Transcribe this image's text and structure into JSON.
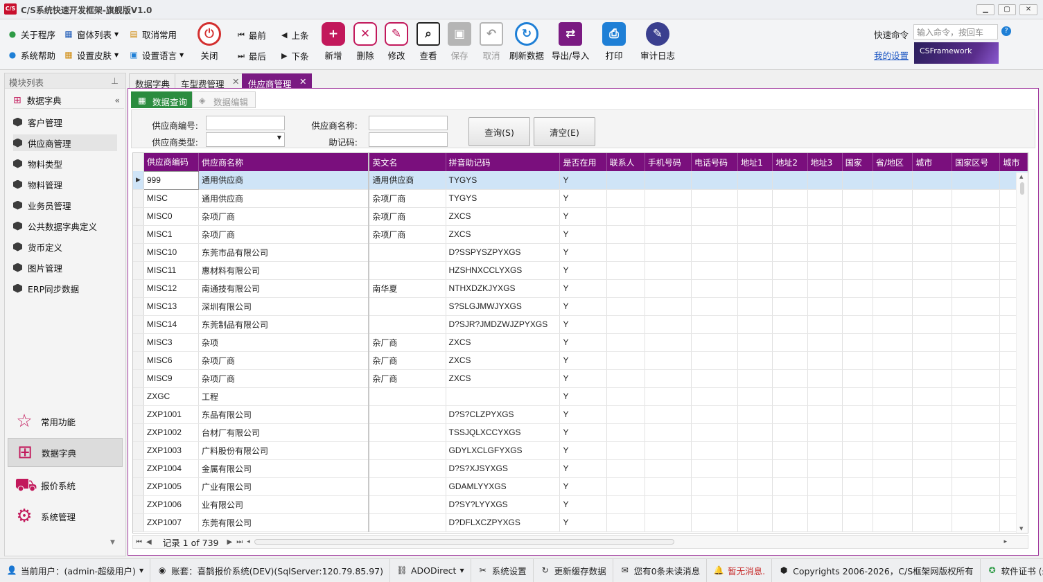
{
  "window": {
    "title": "C/S系统快速开发框架-旗舰版V1.0",
    "icon_text": "C/S",
    "min": "▁",
    "max": "▢",
    "close": "✕"
  },
  "ribbon": {
    "small": [
      {
        "label": "关于程序",
        "icon": "help-circle-icon"
      },
      {
        "label": "系统帮助",
        "icon": "question-icon"
      },
      {
        "label": "窗体列表",
        "icon": "windows-grid-icon"
      },
      {
        "label": "设置皮肤",
        "icon": "palette-grid-icon"
      },
      {
        "label": "取消常用",
        "icon": "clipboard-icon"
      },
      {
        "label": "设置语言",
        "icon": "language-icon"
      }
    ],
    "close": "关闭",
    "nav": {
      "first": "最前",
      "prev": "上条",
      "last": "最后",
      "next": "下条"
    },
    "big": [
      {
        "label": "新增",
        "color": "#c2185b"
      },
      {
        "label": "删除",
        "color": "#c2185b"
      },
      {
        "label": "修改",
        "color": "#c2185b"
      },
      {
        "label": "查看",
        "color": "#222222"
      },
      {
        "label": "保存",
        "color": "#9a9a9a"
      },
      {
        "label": "取消",
        "color": "#9a9a9a"
      },
      {
        "label": "刷新数据",
        "color": "#1e7fd6"
      },
      {
        "label": "导出/导入",
        "color": "#7a1a82"
      },
      {
        "label": "打印",
        "color": "#1e7fd6"
      },
      {
        "label": "审计日志",
        "color": "#3a3f8f"
      }
    ],
    "quick_label": "快速命令",
    "quick_placeholder": "输入命令，按回车",
    "my_settings": "我的设置",
    "banner": "CSFramework"
  },
  "left_panel": {
    "header": "模块列表",
    "group": "数据字典",
    "items": [
      "客户管理",
      "供应商管理",
      "物料类型",
      "物料管理",
      "业务员管理",
      "公共数据字典定义",
      "货币定义",
      "图片管理",
      "ERP同步数据"
    ],
    "big_nav": [
      "常用功能",
      "数据字典",
      "报价系统",
      "系统管理"
    ]
  },
  "doc_tabs": [
    "数据字典",
    "车型费管理",
    "供应商管理"
  ],
  "sub_tabs": [
    "数据查询",
    "数据编辑"
  ],
  "form": {
    "code_label": "供应商编号:",
    "type_label": "供应商类型:",
    "name_label": "供应商名称:",
    "mnemonic_label": "助记码:",
    "query_btn": "查询(S)",
    "clear_btn": "清空(E)"
  },
  "grid": {
    "columns": [
      "供应商编码",
      "供应商名称",
      "英文名",
      "拼音助记码",
      "是否在用",
      "联系人",
      "手机号码",
      "电话号码",
      "地址1",
      "地址2",
      "地址3",
      "国家",
      "省/地区",
      "城市",
      "国家区号",
      "城市"
    ],
    "rows": [
      [
        "999",
        "通用供应商",
        "通用供应商",
        "TYGYS",
        "Y"
      ],
      [
        "MISC",
        "通用供应商",
        "杂项厂商",
        "TYGYS",
        "Y"
      ],
      [
        "MISC0",
        "杂项厂商",
        "杂项厂商",
        "ZXCS",
        "Y"
      ],
      [
        "MISC1",
        "杂项厂商",
        "杂项厂商",
        "ZXCS",
        "Y"
      ],
      [
        "MISC10",
        "东莞市品有限公司",
        "",
        "D?SSPYSZPYXGS",
        "Y"
      ],
      [
        "MISC11",
        "惠材料有限公司",
        "",
        "HZSHNXCCLYXGS",
        "Y"
      ],
      [
        "MISC12",
        "南通技有限公司",
        "南华夏",
        "NTHXDZKJYXGS",
        "Y"
      ],
      [
        "MISC13",
        "深圳有限公司",
        "",
        "S?SLGJMWJYXGS",
        "Y"
      ],
      [
        "MISC14",
        "东莞制品有限公司",
        "",
        "D?SJR?JMDZWJZPYXGS",
        "Y"
      ],
      [
        "MISC3",
        "杂项",
        "杂厂商",
        "ZXCS",
        "Y"
      ],
      [
        "MISC6",
        "杂项厂商",
        "杂厂商",
        "ZXCS",
        "Y"
      ],
      [
        "MISC9",
        "杂项厂商",
        "杂厂商",
        "ZXCS",
        "Y"
      ],
      [
        "ZXGC",
        "工程",
        "",
        "",
        "Y"
      ],
      [
        "ZXP1001",
        "东品有限公司",
        "",
        "D?S?CLZPYXGS",
        "Y"
      ],
      [
        "ZXP1002",
        "台材厂有限公司",
        "",
        "TSSJQLXCCYXGS",
        "Y"
      ],
      [
        "ZXP1003",
        "广料股份有限公司",
        "",
        "GDYLXCLGFYXGS",
        "Y"
      ],
      [
        "ZXP1004",
        "金属有限公司",
        "",
        "D?S?XJSYXGS",
        "Y"
      ],
      [
        "ZXP1005",
        "广业有限公司",
        "",
        "GDAMLYYXGS",
        "Y"
      ],
      [
        "ZXP1006",
        "业有限公司",
        "",
        "D?SY?LYYXGS",
        "Y"
      ],
      [
        "ZXP1007",
        "东莞有限公司",
        "",
        "D?DFLXCZPYXGS",
        "Y"
      ]
    ],
    "record_text": "记录 1 of 739"
  },
  "status": {
    "user": "当前用户：(admin-超级用户)",
    "account": "账套：喜鹊报价系统(DEV)(SqlServer:120.79.85.97)",
    "conn": "ADODirect",
    "settings": "系统设置",
    "cache": "更新缓存数据",
    "unread": "您有0条未读消息",
    "msg": "暂无消息.",
    "copyright": "Copyrights 2006-2026，C/S框架网版权所有",
    "license": "软件证书  (永久授权)"
  }
}
